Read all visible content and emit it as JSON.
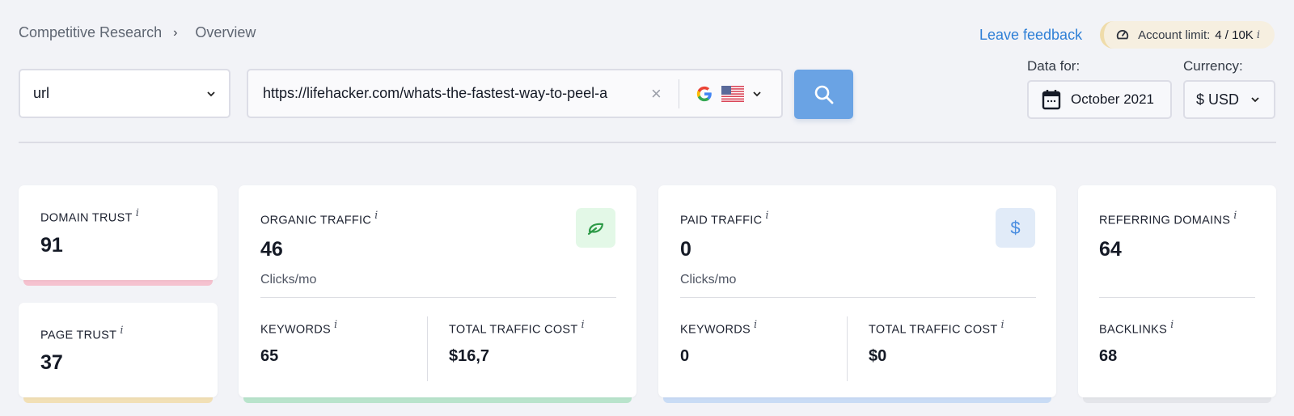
{
  "breadcrumb": {
    "items": [
      "Competitive Research",
      "Overview"
    ],
    "separator": "›"
  },
  "header": {
    "feedback_link": "Leave feedback",
    "account_limit": {
      "label": "Account limit:",
      "value": "4 / 10K",
      "info": "i",
      "icon": "gauge-icon"
    }
  },
  "search": {
    "type_select": {
      "value": "url",
      "icon": "chevron-down-icon"
    },
    "url_input": {
      "value": "https://lifehacker.com/whats-the-fastest-way-to-peel-a",
      "clear_icon": "×"
    },
    "engine": {
      "search_engine": "Google",
      "country": "United States"
    },
    "search_button_icon": "search-icon"
  },
  "filters": {
    "data_for": {
      "label": "Data for:",
      "value": "October 2021",
      "icon": "calendar-icon"
    },
    "currency": {
      "label": "Currency:",
      "value": "$ USD"
    }
  },
  "colors": {
    "accent": "#6aa3e4",
    "link": "#2e7fd6",
    "domain_trust_bar": "#f5c2cf",
    "page_trust_bar": "#f2e0b6",
    "organic_bar": "#b9e4cc",
    "paid_bar": "#c9dcf5",
    "referring_bar": "#e4e5ea"
  },
  "cards": {
    "domain_trust": {
      "title": "Domain Trust",
      "value": "91",
      "info": "i"
    },
    "page_trust": {
      "title": "Page Trust",
      "value": "37",
      "info": "i"
    },
    "organic": {
      "title": "Organic Traffic",
      "value": "46",
      "unit": "Clicks/mo",
      "info": "i",
      "icon": "leaf-icon",
      "keywords": {
        "title": "Keywords",
        "value": "65",
        "info": "i"
      },
      "cost": {
        "title": "Total Traffic Cost",
        "value": "$16,7",
        "info": "i"
      }
    },
    "paid": {
      "title": "Paid Traffic",
      "value": "0",
      "unit": "Clicks/mo",
      "info": "i",
      "icon": "dollar-icon",
      "icon_glyph": "$",
      "keywords": {
        "title": "Keywords",
        "value": "0",
        "info": "i"
      },
      "cost": {
        "title": "Total Traffic Cost",
        "value": "$0",
        "info": "i"
      }
    },
    "referring": {
      "title": "Referring Domains",
      "value": "64",
      "info": "i",
      "backlinks": {
        "title": "Backlinks",
        "value": "68",
        "info": "i"
      }
    }
  }
}
